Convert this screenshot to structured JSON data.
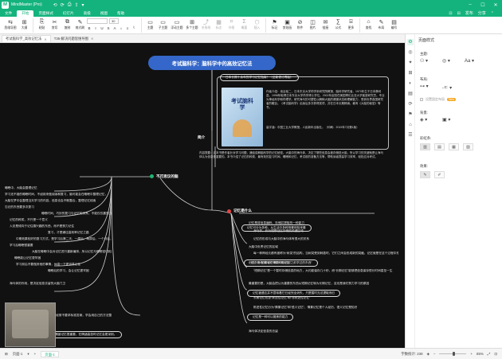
{
  "app": {
    "title": "MindMaster (Pro)",
    "logo": "M"
  },
  "titlebar_tools": [
    "⟲",
    "⟳",
    "⎙",
    "⇪",
    "▾"
  ],
  "menu": {
    "items": [
      "文件",
      "开始",
      "页面样式",
      "幻灯片",
      "高级",
      "视图",
      "帮助"
    ],
    "active_index": 1,
    "right": [
      "⊡",
      "⊟",
      "发布",
      "分享",
      "⌃"
    ]
  },
  "ribbon": {
    "groups": [
      {
        "icon": "⇆",
        "label": "思维导图"
      },
      {
        "icon": "⊞",
        "label": "大纲"
      },
      {
        "icon": "⎘",
        "label": "粘贴"
      },
      {
        "icon": "✂",
        "label": "剪切"
      },
      {
        "icon": "⧉",
        "label": "复制"
      },
      {
        "icon": "✎",
        "label": "格式刷"
      },
      {
        "icon": "▭",
        "label": "主题"
      },
      {
        "icon": "▭",
        "label": "子主题"
      },
      {
        "icon": "▭",
        "label": "浮动主题"
      },
      {
        "icon": "⊞",
        "label": "多个主题"
      },
      {
        "icon": "⤴",
        "label": "关系线",
        "grey": true
      },
      {
        "icon": "▦",
        "label": "标注",
        "grey": true
      },
      {
        "icon": "⌗",
        "label": "外框",
        "grey": true
      },
      {
        "icon": "Σ",
        "label": "概要",
        "grey": true
      },
      {
        "icon": "⬡",
        "label": "插入",
        "grey": true
      },
      {
        "icon": "⚑",
        "label": "标记"
      },
      {
        "icon": "▣",
        "label": "剪贴画"
      },
      {
        "icon": "⊘",
        "label": "附件"
      },
      {
        "icon": "◫",
        "label": "图片"
      },
      {
        "icon": "✉",
        "label": "链接"
      },
      {
        "icon": "∑",
        "label": "公式"
      },
      {
        "icon": "⌸",
        "label": "更多"
      },
      {
        "icon": "⌂",
        "label": "查找"
      },
      {
        "icon": "✎",
        "label": "布局"
      },
      {
        "icon": "▤",
        "label": "编号"
      }
    ],
    "font_value": "",
    "size_value": "30",
    "font_buttons": [
      "B",
      "I",
      "U",
      "S"
    ],
    "extra_buttons": [
      "A",
      "⌂",
      "≡",
      "⌇"
    ]
  },
  "doc_tabs": [
    {
      "label": "考试脑科学_高效记忆法",
      "active": true
    },
    {
      "label": "T35-解决问题思维导图",
      "active": false
    }
  ],
  "canvas": {
    "root": "考试脑科学：脑科学中的高效记忆法",
    "intro_label": "简介",
    "intro_top_pill": "日本长期十余年的学习记忆指南！（全新修订再版）",
    "book_title": "考试脑科学",
    "author_para": "作者介绍：池谷裕二，日本东京大学药学系研究院教授，脑科学研究者。1970年生于日本静冈县。1998年取得日本东京大学药学博士学位。2002年起担任美国哥伦比亚大学客座研究员。专业为神经科学和药理学。研究海马的可塑性以解释大脑的健康状态和理解能力，受到世界各国研究者的瞩目。《考试脑科学》出版后多次获得奖项，并在日本长期畅销。著有《大脑的秘密》等书。",
    "translator_para": "高宇涵：中国工业大学教授，人民新年出版社。（印刷：2019年7月第1版）",
    "content_para": "内容提要：这本书是作者针对学习问题，通俗讲解脑科学的记忆秘密。大脑中的海马体，决定了哪些信息会被存储进大脑，所以学习的关键就是让海马体认为信息是重要的。本书介绍了记忆的种类、最有效的复习时间、睡眠和记忆、考试前的准备方法等，帮助读者提高学习效率，轻松应对考试。",
    "left_branch_title": "不可思议的脑",
    "left_nodes": [
      "睡眠中，大脑会整理记忆",
      "学习还不错的睡眠时间，不如用来做阅读和复习，脑可能会在睡眠中整理记忆，",
      "大脑在梦中会整理当天学习的内容，信息也会不断整合，整理记忆线索",
      "忘记的东西要多次复习",
      "睡眠时间，巧妙的复习与记忆的关系，不能仅仅靠努力，大脑需要复习的时间和次数",
      "记忆的种类，不只是一个意义",
      "人总是倾向于记住感兴趣的东西，而不是努力记住",
      "复习，才是通往高效率记忆之路",
      "中期效果较好的复习方式，是学习后第二天、一周后、两周后、一个月后，总共四次的复习节奏",
      "学习后睡眠很重要",
      "大脑在睡眠中会对记忆进行重新编排，所以记忆与睡眠密切相关",
      "睡眠能让记忆更牢固",
      "学习前后不要做其他的事情，休息一下更容易记住",
      "睡眠后的学习，会让记忆更牢固",
      "海马体的作用，是决定信息去留的大脑门卫",
      "模拟考试中，经常不要求标准答案，学会用自己的方法整理记忆"
    ],
    "left_pills": [
      "情绪记忆很重要，在情绪高涨时记忆会更深刻。"
    ],
    "right_branch_title": "记忆是什么",
    "right_nodes": [
      "记忆是将信息编码、存储并提取的一种能力",
      "海马体，作为短期记忆存储的关键区域",
      "记忆的形成与大脑中的海马体有很大的关系",
      "大脑中负责记忆的区域",
      "每一种神经元都有被称为“树突”的结构，当树突受到刺激时，它们之间会形成新的突触，记忆就是在这个过程中形成的",
      "记忆分为“短期记忆”和“长期记忆”",
      "“短期记忆”是一个暂时存储信息的地方，大约能保存几十秒，而“长期记忆”能够把信息保存很长时间甚至一生",
      "最重要的是，大脑会把认为重要的东西从短期记忆转为长期记忆，这也是我们努力学习的原因",
      "长期记忆包含“陈述性记忆”和“非陈述性记忆”",
      "陈述性记忆分为“情景记忆”和“语义记忆”，情景记忆是个人经历，语义记忆是知识",
      "海马体决定信息的去留"
    ],
    "right_pills": [
      "记忆可分为多种，从生活中多种场景体验来看",
      "“记忆”是指“能够在需要时回忆起之前学过的东西”",
      "记忆被遗忘并不意味着它已经完全消失，只是暂时无法提取而已",
      "记忆是一种可以锻炼的能力"
    ]
  },
  "panel": {
    "title": "页面样式",
    "sections": {
      "theme": "主题:",
      "layout": "布局:",
      "checkbox": "设置固定布局",
      "new": "New",
      "background": "背景:",
      "rainbow": "彩虹条:",
      "effect": "效果:"
    },
    "side_icons": [
      "⚙",
      "◎",
      "✦",
      "⊞",
      "◐",
      "▤",
      "⟳",
      "⚑",
      "⌂",
      "☰"
    ]
  },
  "status": {
    "page_label": "页面-1",
    "add": "+",
    "page_tab": "页面-1",
    "word_count": "字数统计: 238",
    "zoom": "85%",
    "zoom_fraction": 0.55,
    "icons": [
      "◈",
      "⤢",
      "⊡"
    ]
  },
  "colors": {
    "brand": "#14b37d",
    "root": "#3467c9",
    "canvas": "#111111",
    "left_marker": "#22b573",
    "right_marker": "#e24444"
  }
}
